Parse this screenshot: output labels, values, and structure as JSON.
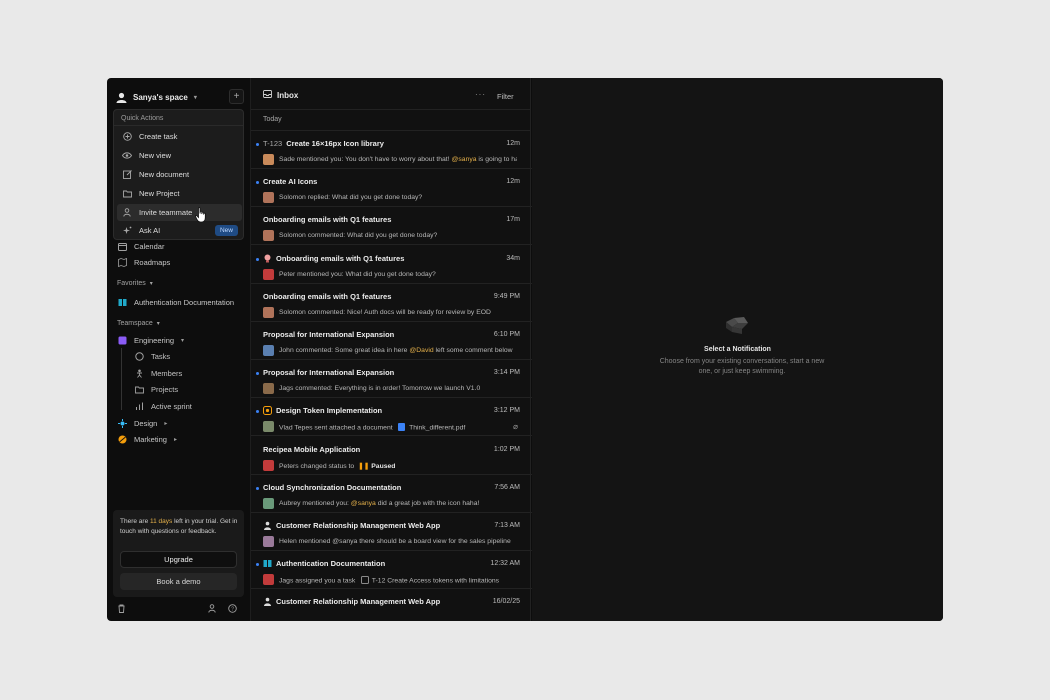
{
  "workspace": {
    "name": "Sanya's space"
  },
  "quick_actions": {
    "header": "Quick Actions",
    "items": [
      {
        "label": "Create task",
        "icon": "plus-circle-icon"
      },
      {
        "label": "New view",
        "icon": "eye-icon"
      },
      {
        "label": "New document",
        "icon": "edit-document-icon"
      },
      {
        "label": "New Project",
        "icon": "folder-icon"
      },
      {
        "label": "Invite teammate",
        "icon": "user-plus-icon"
      },
      {
        "label": "Ask AI",
        "icon": "sparkles-icon",
        "badge": "New"
      }
    ]
  },
  "nav": {
    "calendar": "Calendar",
    "roadmaps": "Roadmaps"
  },
  "favorites": {
    "label": "Favorites",
    "items": [
      {
        "label": "Authentication Documentation"
      }
    ]
  },
  "teamspace": {
    "label": "Teamspace",
    "engineering": "Engineering",
    "sub_items": [
      {
        "label": "Tasks"
      },
      {
        "label": "Members"
      },
      {
        "label": "Projects"
      },
      {
        "label": "Active sprint"
      }
    ],
    "design": "Design",
    "marketing": "Marketing"
  },
  "trial": {
    "text_before": "There are ",
    "days": "11 days",
    "text_after": " left in your trial. Get in touch with questions or feedback.",
    "upgrade": "Upgrade",
    "demo": "Book a demo"
  },
  "inbox": {
    "title": "Inbox",
    "more": "···",
    "filter": "Filter",
    "group": "Today",
    "notifications": [
      {
        "code": "T-123",
        "title": "Create 16×16px Icon library",
        "time": "12m",
        "unread": true,
        "msg_before": "Sade mentioned you: You don't have to worry about that! ",
        "mention": "@sanya",
        "msg_after": " is going to handle it",
        "avatar_color": "#c98a5a"
      },
      {
        "code": "",
        "title": "Create AI Icons",
        "time": "12m",
        "unread": true,
        "msg_before": "Solomon replied: What did you get done today?",
        "mention": "",
        "msg_after": "",
        "avatar_color": "#b0735a"
      },
      {
        "code": "",
        "title": "Onboarding emails with Q1 features",
        "time": "17m",
        "unread": false,
        "msg_before": "Solomon commented: What did you get done today?",
        "mention": "",
        "msg_after": "",
        "avatar_color": "#b0735a"
      },
      {
        "code": "",
        "title": "Onboarding emails with Q1 features",
        "time": "34m",
        "unread": true,
        "msg_before": "Peter mentioned you: What did you get done today?",
        "mention": "",
        "msg_after": "",
        "avatar_color": "#c23b3b",
        "icon": "bulb-icon"
      },
      {
        "code": "",
        "title": "Onboarding emails with Q1 features",
        "time": "9:49 PM",
        "unread": false,
        "msg_before": "Solomon commented: Nice! Auth docs will be ready for review by EOD",
        "mention": "",
        "msg_after": "",
        "avatar_color": "#b0735a"
      },
      {
        "code": "",
        "title": "Proposal for International Expansion",
        "time": "6:10 PM",
        "unread": false,
        "msg_before": "John commented: Some great idea in here ",
        "mention": "@David",
        "msg_after": " left some comment below",
        "avatar_color": "#5a7fb0"
      },
      {
        "code": "",
        "title": "Proposal for International Expansion",
        "time": "3:14 PM",
        "unread": true,
        "msg_before": "Jags commented: Everything is in order! Tomorrow we launch V1.0",
        "mention": "",
        "msg_after": "",
        "avatar_color": "#8a6a4a"
      },
      {
        "code": "",
        "title": "Design Token Implementation",
        "time": "3:12 PM",
        "unread": true,
        "msg_before": "Vlad Tepes sent attached a document",
        "mention": "",
        "msg_after": "",
        "attachment": "Think_different.pdf",
        "avatar_color": "#7a8a6a",
        "icon": "token-icon"
      },
      {
        "code": "",
        "title": "Recipea Mobile Application",
        "time": "1:02 PM",
        "unread": false,
        "msg_before": "Peters changed status to ",
        "mention": "",
        "msg_after": "",
        "status": "Paused",
        "avatar_color": "#c23b3b"
      },
      {
        "code": "",
        "title": "Cloud Synchronization Documentation",
        "time": "7:56 AM",
        "unread": true,
        "msg_before": "Aubrey mentioned you: ",
        "mention": "@sanya",
        "msg_after": " did a great job with the icon haha!",
        "avatar_color": "#6a9a7a"
      },
      {
        "code": "",
        "title": "Customer Relationship Management Web App",
        "time": "7:13 AM",
        "unread": false,
        "msg_before": "Helen mentioned @sanya there should be a board view for the sales pipeline",
        "mention": "",
        "msg_after": "",
        "avatar_color": "#9a7a9a",
        "icon": "user-icon"
      },
      {
        "code": "",
        "title": "Authentication Documentation",
        "time": "12:32 AM",
        "unread": true,
        "msg_before": "Jags assigned you a task ",
        "mention": "",
        "msg_after": "",
        "task": "T-12 Create Access tokens with limitations",
        "avatar_color": "#c23b3b",
        "icon": "book-icon"
      },
      {
        "code": "",
        "title": "Customer Relationship Management Web App",
        "time": "16/02/25",
        "unread": false,
        "msg_before": "",
        "mention": "",
        "msg_after": "",
        "avatar_color": "#9a7a9a",
        "icon": "user-icon"
      }
    ]
  },
  "detail": {
    "title": "Select a Notification",
    "text": "Choose from your existing conversations, start a new one, or just keep swimming."
  },
  "colors": {
    "accent": "#3b82f6",
    "mention": "#e4b04a",
    "background": "#0d0d0d"
  }
}
